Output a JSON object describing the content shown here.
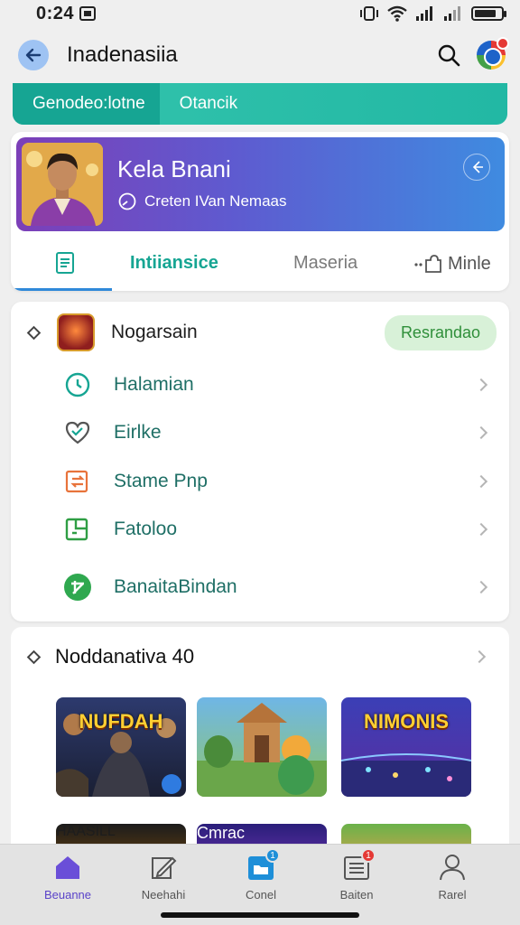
{
  "status_bar": {
    "time": "0:24"
  },
  "app_bar": {
    "title": "Inadenasiia"
  },
  "teal_banner": {
    "segments": [
      "Genodeo:lotne",
      "Otancik"
    ]
  },
  "profile": {
    "name": "Kela Bnani",
    "subtitle": "Creten IVan Nemaas"
  },
  "tabs": [
    {
      "label": "Intiiansice"
    },
    {
      "label": "Maseria"
    },
    {
      "label": "Minle"
    }
  ],
  "list_section": {
    "title": "Nogarsain",
    "pill": "Resrandao",
    "items": [
      {
        "label": "Halamian",
        "icon": "clock-icon"
      },
      {
        "label": "Eirlke",
        "icon": "heart-icon"
      },
      {
        "label": "Stame Pnp",
        "icon": "swap-icon"
      },
      {
        "label": "Fatoloo",
        "icon": "puzzle-icon"
      },
      {
        "label": "BanaitaBindan",
        "icon": "grid-icon"
      }
    ]
  },
  "games_section": {
    "title": "Noddanativa 40",
    "thumbs": [
      {
        "title": "NUFDAH"
      },
      {
        "title": ""
      },
      {
        "title": "NIMONIS"
      }
    ],
    "row2_thumbs": [
      {
        "title": "HAASILL"
      },
      {
        "title": "Cmrac"
      },
      {
        "title": ""
      }
    ]
  },
  "bottom_nav": [
    {
      "label": "Beuanne",
      "icon": "home-icon"
    },
    {
      "label": "Neehahi",
      "icon": "edit-icon"
    },
    {
      "label": "Conel",
      "icon": "folder-icon",
      "badge": "1"
    },
    {
      "label": "Baiten",
      "icon": "news-icon",
      "badge": "1"
    },
    {
      "label": "Rarel",
      "icon": "person-icon"
    }
  ],
  "colors": {
    "accent_teal": "#16a593",
    "accent_purple": "#5a43c9",
    "pill_green": "#2f8f3a"
  }
}
